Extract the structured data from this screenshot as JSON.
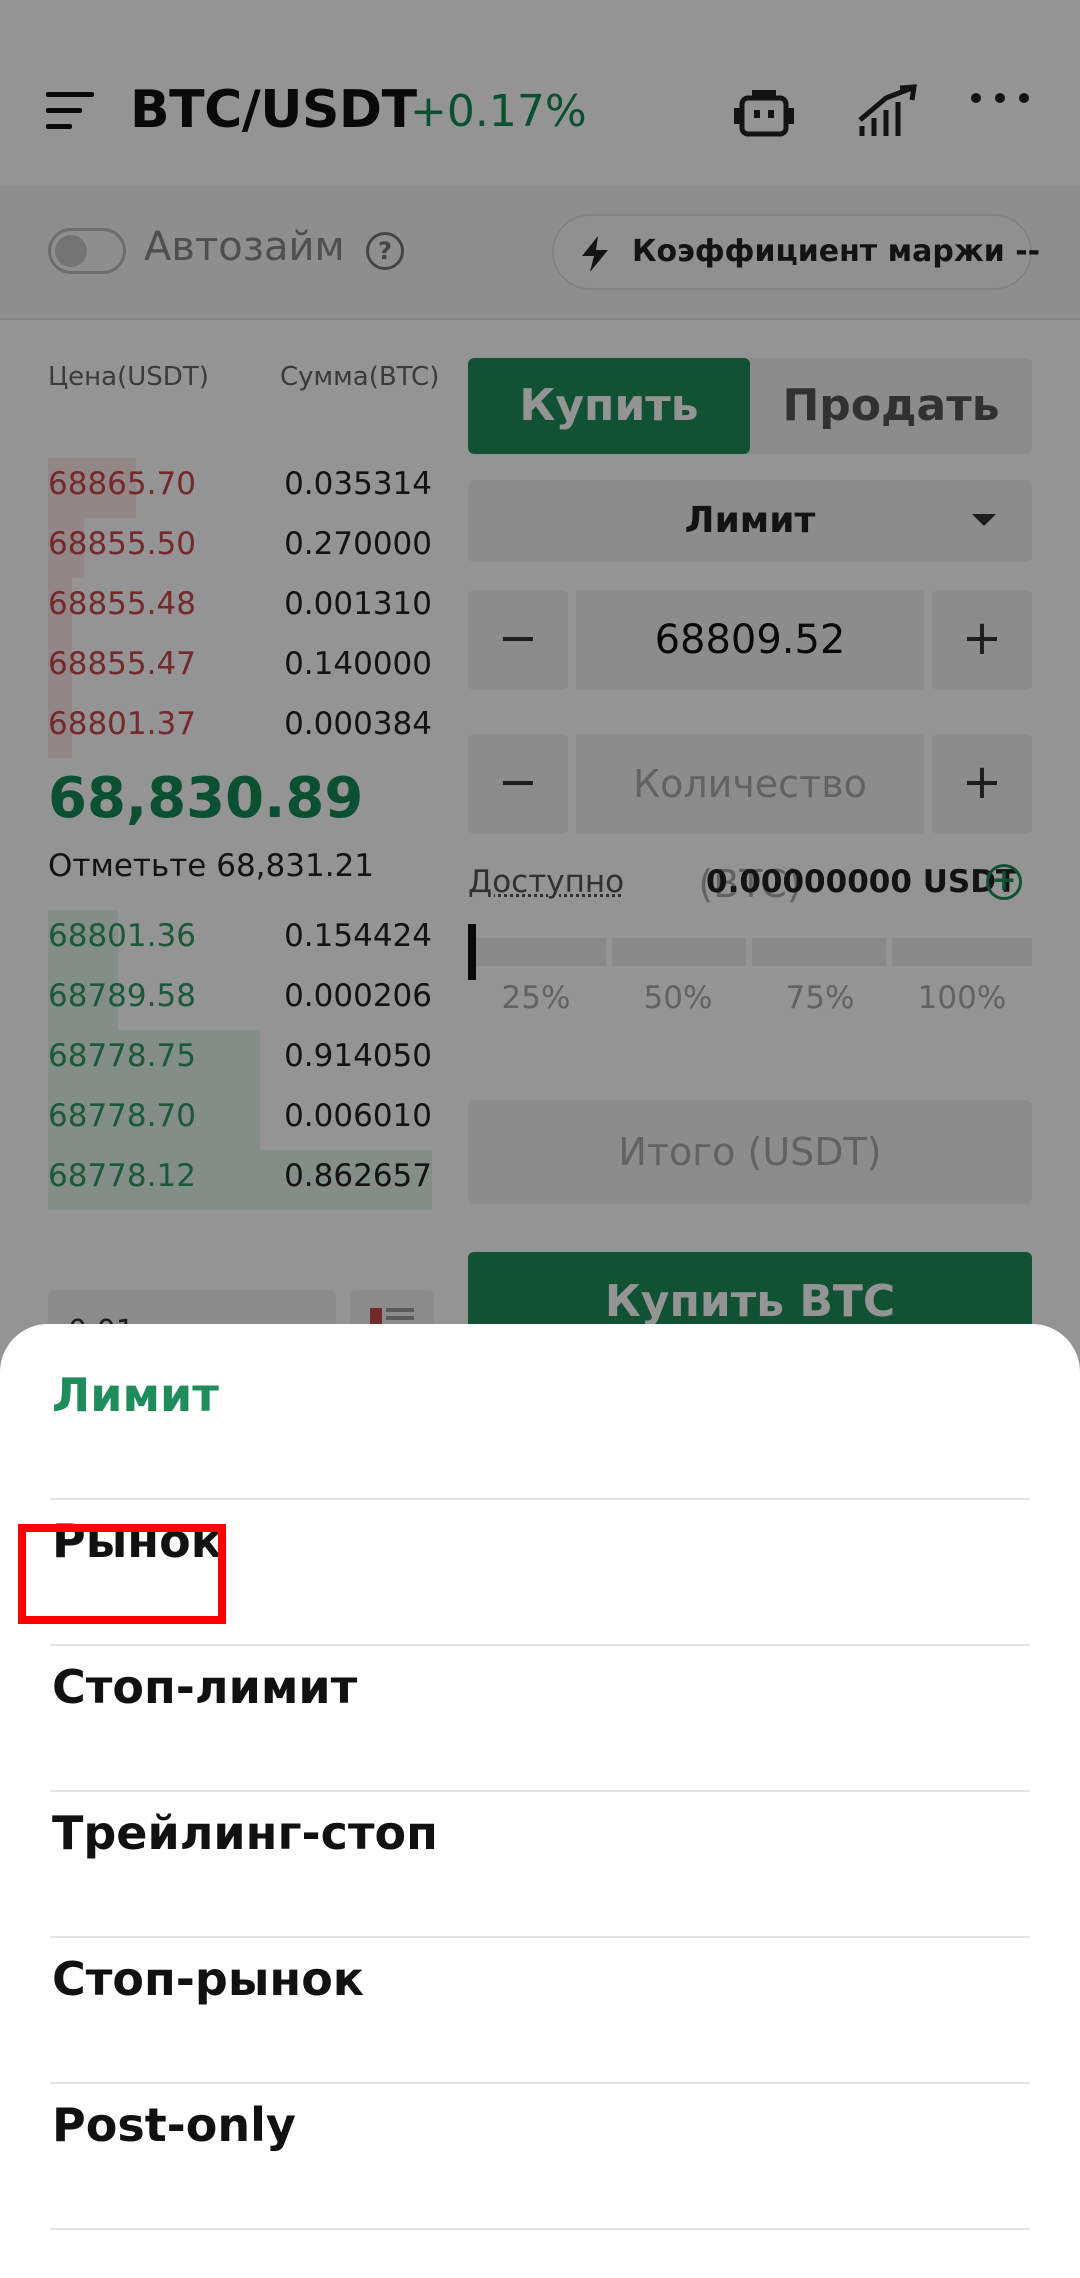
{
  "header": {
    "pair": "BTC/USDT",
    "change": "+0.17%",
    "icons": [
      "menu-icon",
      "robot-icon",
      "chart-icon",
      "more-icon"
    ]
  },
  "margin_bar": {
    "autoloan_label": "Автозайм",
    "help_glyph": "?",
    "margin_ratio_label": "Коэффициент маржи --"
  },
  "orderbook": {
    "price_header": "Цена(USDT)",
    "amount_header": "Сумма(BTC)",
    "asks": [
      {
        "price": "68865.70",
        "amount": "0.035314",
        "depth": 0.2
      },
      {
        "price": "68855.50",
        "amount": "0.270000",
        "depth": 0.09
      },
      {
        "price": "68855.48",
        "amount": "0.001310",
        "depth": 0.05
      },
      {
        "price": "68855.47",
        "amount": "0.140000",
        "depth": 0.05
      },
      {
        "price": "68801.37",
        "amount": "0.000384",
        "depth": 0.05
      }
    ],
    "last_price": "68,830.89",
    "mark_price": "Отметьте 68,831.21",
    "bids": [
      {
        "price": "68801.36",
        "amount": "0.154424",
        "depth": 0.18
      },
      {
        "price": "68789.58",
        "amount": "0.000206",
        "depth": 0.18
      },
      {
        "price": "68778.75",
        "amount": "0.914050",
        "depth": 0.68
      },
      {
        "price": "68778.70",
        "amount": "0.006010",
        "depth": 0.68
      },
      {
        "price": "68778.12",
        "amount": "0.862657",
        "depth": 1.0
      }
    ],
    "precision": "0.01"
  },
  "order_form": {
    "buy_tab": "Купить",
    "sell_tab": "Продать",
    "order_type": "Лимит",
    "price_value": "68809.52",
    "minus": "−",
    "plus": "+",
    "quantity_placeholder": "Количество (BTC)",
    "available_label": "Доступно",
    "available_value": "0.00000000 USDT",
    "available_plus": "+",
    "percent_options": [
      "25%",
      "50%",
      "75%",
      "100%"
    ],
    "slider_value": 0,
    "total_placeholder": "Итого (USDT)",
    "buy_button": "Купить BTC"
  },
  "order_type_sheet": {
    "options": [
      {
        "label": "Лимит",
        "active": true
      },
      {
        "label": "Рынок",
        "active": false
      },
      {
        "label": "Стоп-лимит",
        "active": false
      },
      {
        "label": "Трейлинг-стоп",
        "active": false
      },
      {
        "label": "Стоп-рынок",
        "active": false
      },
      {
        "label": "Post-only",
        "active": false
      }
    ],
    "highlighted_option": "Рынок",
    "accent_color": "#1e8d5b"
  },
  "colors": {
    "green": "#1e8d5b",
    "red_price": "#c9474c",
    "highlight_box": "#ff0000"
  }
}
